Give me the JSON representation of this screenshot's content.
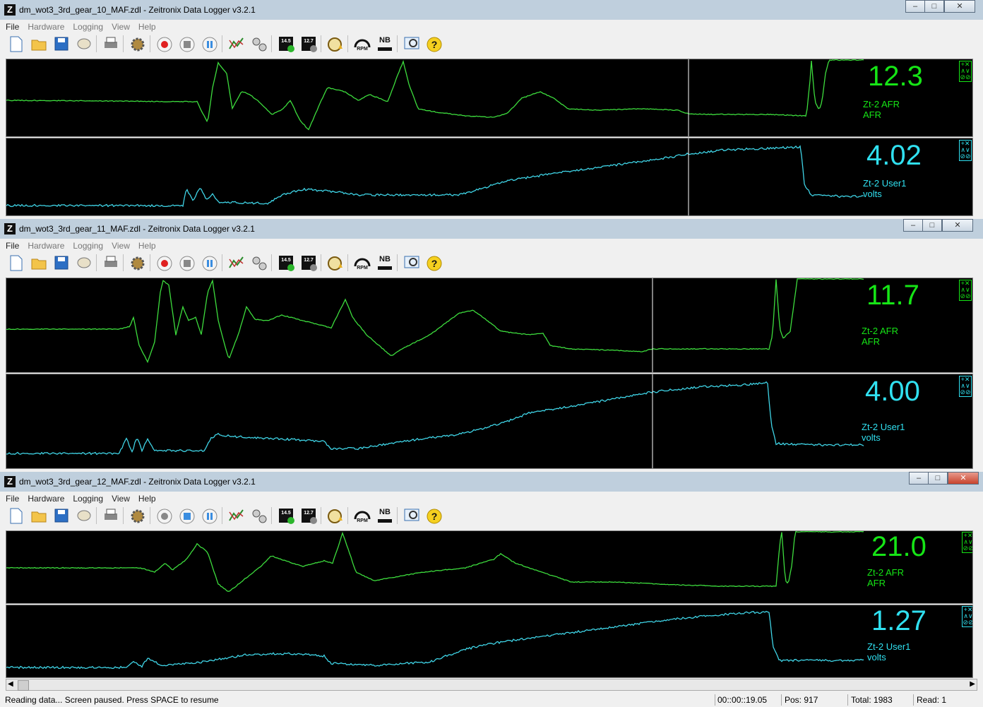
{
  "windows": [
    {
      "title": "dm_wot3_3rd_gear_10_MAF.zdl - Zeitronix Data Logger v3.2.1",
      "afr_value": "12.3",
      "afr_name": "Zt-2 AFR",
      "afr_unit": "AFR",
      "user_value": "4.02",
      "user_name": "Zt-2 User1",
      "user_unit": "volts"
    },
    {
      "title": "dm_wot3_3rd_gear_11_MAF.zdl - Zeitronix Data Logger v3.2.1",
      "afr_value": "11.7",
      "afr_name": "Zt-2 AFR",
      "afr_unit": "AFR",
      "user_value": "4.00",
      "user_name": "Zt-2 User1",
      "user_unit": "volts"
    },
    {
      "title": "dm_wot3_3rd_gear_12_MAF.zdl - Zeitronix Data Logger v3.2.1",
      "afr_value": "21.0",
      "afr_name": "Zt-2 AFR",
      "afr_unit": "AFR",
      "user_value": "1.27",
      "user_name": "Zt-2 User1",
      "user_unit": "volts"
    }
  ],
  "menu": {
    "file": "File",
    "hardware": "Hardware",
    "logging": "Logging",
    "view": "View",
    "help": "Help"
  },
  "toolbar": {
    "afr_target_1": "14.5",
    "afr_target_2": "12.7",
    "nb_label": "NB",
    "rpm_label": "RPM"
  },
  "status": {
    "message": "Reading data...  Screen paused.  Press SPACE to resume",
    "time": "00::00::19.05",
    "pos": "Pos: 917",
    "total": "Total: 1983",
    "read": "Read: 1"
  },
  "colors": {
    "afr_trace": "#3ddc3d",
    "user_trace": "#3fd4e6",
    "afr_text": "#16e516",
    "user_text": "#30e0f0"
  }
}
